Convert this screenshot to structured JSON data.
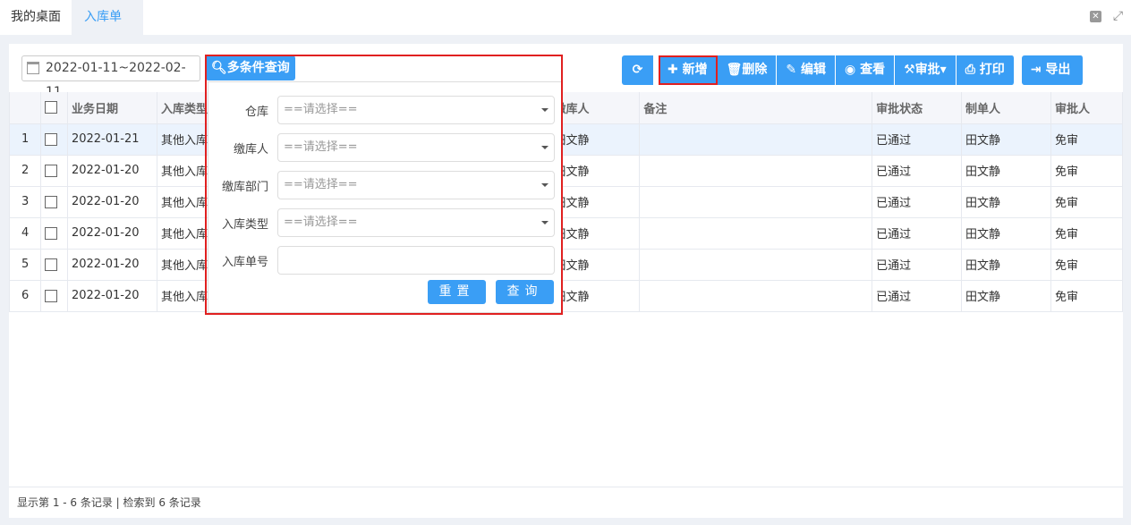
{
  "tabs": [
    "我的桌面",
    "入库单"
  ],
  "date_range": "2022-01-11~2022-02-11",
  "query_button": "多条件查询",
  "toolbar": {
    "add": "新增",
    "delete": "删除",
    "edit": "编辑",
    "view": "查看",
    "approve": "审批",
    "print": "打印",
    "export": "导出"
  },
  "columns": [
    "",
    "",
    "业务日期",
    "入库类型",
    "",
    "",
    "",
    "缴库人",
    "备注",
    "审批状态",
    "制单人",
    "审批人"
  ],
  "rows": [
    {
      "n": "1",
      "date": "2022-01-21",
      "type": "其他入库",
      "payer": "田文静",
      "note": "",
      "status": "已通过",
      "maker": "田文静",
      "approver": "免审"
    },
    {
      "n": "2",
      "date": "2022-01-20",
      "type": "其他入库",
      "payer": "田文静",
      "note": "",
      "status": "已通过",
      "maker": "田文静",
      "approver": "免审"
    },
    {
      "n": "3",
      "date": "2022-01-20",
      "type": "其他入库",
      "payer": "田文静",
      "note": "",
      "status": "已通过",
      "maker": "田文静",
      "approver": "免审"
    },
    {
      "n": "4",
      "date": "2022-01-20",
      "type": "其他入库",
      "payer": "田文静",
      "note": "",
      "status": "已通过",
      "maker": "田文静",
      "approver": "免审"
    },
    {
      "n": "5",
      "date": "2022-01-20",
      "type": "其他入库",
      "payer": "田文静",
      "note": "",
      "status": "已通过",
      "maker": "田文静",
      "approver": "免审"
    },
    {
      "n": "6",
      "date": "2022-01-20",
      "type": "其他入库",
      "payer": "田文静",
      "note": "",
      "status": "已通过",
      "maker": "田文静",
      "approver": "免审"
    }
  ],
  "footer": "显示第 1 - 6 条记录 | 检索到 6 条记录",
  "filter": {
    "fields": [
      {
        "label": "仓库",
        "placeholder": "==请选择=="
      },
      {
        "label": "缴库人",
        "placeholder": "==请选择=="
      },
      {
        "label": "缴库部门",
        "placeholder": "==请选择=="
      },
      {
        "label": "入库类型",
        "placeholder": "==请选择=="
      },
      {
        "label": "入库单号",
        "placeholder": ""
      }
    ],
    "reset": "重置",
    "search": "查询"
  },
  "colors": {
    "accent": "#3a9ef5",
    "highlight": "#e02020"
  }
}
